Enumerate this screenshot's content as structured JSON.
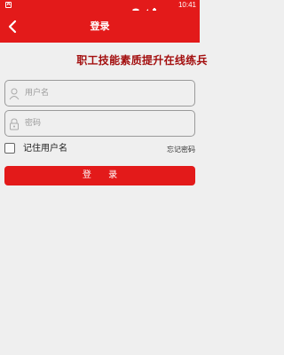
{
  "status_bar": {
    "notification_badge": "A",
    "time": "10:41"
  },
  "app_bar": {
    "title": "登录"
  },
  "slogan": "职工技能素质提升在线练兵",
  "form": {
    "username": {
      "placeholder": "用户名",
      "value": ""
    },
    "password": {
      "placeholder": "密码",
      "value": ""
    },
    "remember_label": "记住用户名",
    "remember_checked": false,
    "forgot_label": "忘记密码",
    "login_label": "登 录"
  },
  "colors": {
    "primary": "#e31a1a",
    "slogan": "#a30e0e",
    "background": "#efefef"
  }
}
